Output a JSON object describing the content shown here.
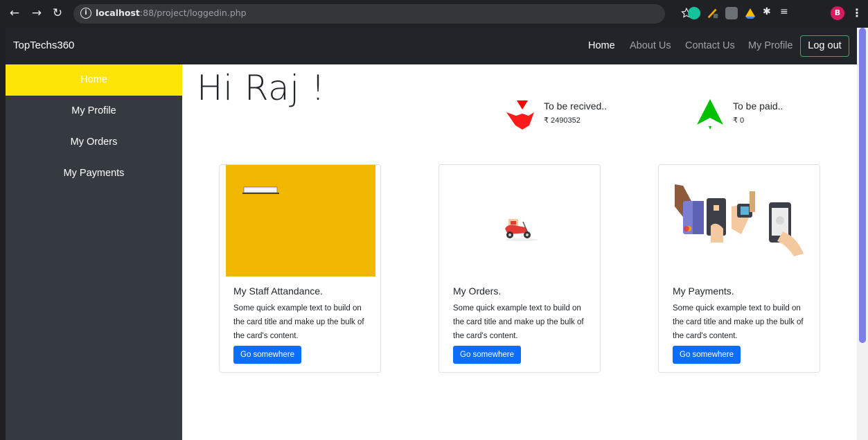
{
  "browser": {
    "url_host": "localhost",
    "url_rest": ":88/project/loggedin.php",
    "profile_initial": "B"
  },
  "navbar": {
    "brand": "TopTechs360",
    "links": [
      "Home",
      "About Us",
      "Contact Us",
      "My Profile"
    ],
    "logout": "Log out"
  },
  "sidebar": {
    "items": [
      {
        "label": "Home",
        "active": true
      },
      {
        "label": "My Profile"
      },
      {
        "label": "My Orders"
      },
      {
        "label": "My Payments"
      }
    ]
  },
  "main": {
    "greeting": "Hi Raj !",
    "receive": {
      "title": "To be recived..",
      "value": "₹ 2490352",
      "icon": "arrow-down-icon",
      "color": "#ff0000"
    },
    "pay": {
      "title": "To be paid..",
      "value": "₹ 0",
      "icon": "arrow-up-icon",
      "color": "#00c000"
    }
  },
  "cards": [
    {
      "title": "My Staff Attandance.",
      "text": "Some quick example text to build on the card title and make up the bulk of the card's content.",
      "button": "Go somewhere"
    },
    {
      "title": "My Orders.",
      "text": "Some quick example text to build on the card title and make up the bulk of the card's content.",
      "button": "Go somewhere"
    },
    {
      "title": "My Payments.",
      "text": "Some quick example text to build on the card title and make up the bulk of the card's content.",
      "button": "Go somewhere"
    }
  ],
  "colors": {
    "sidebar_active": "#fde507",
    "sidebar_bg": "#343a40",
    "navbar_bg": "#212529",
    "primary": "#0d6efd",
    "attendance_bg": "#f0b800"
  }
}
